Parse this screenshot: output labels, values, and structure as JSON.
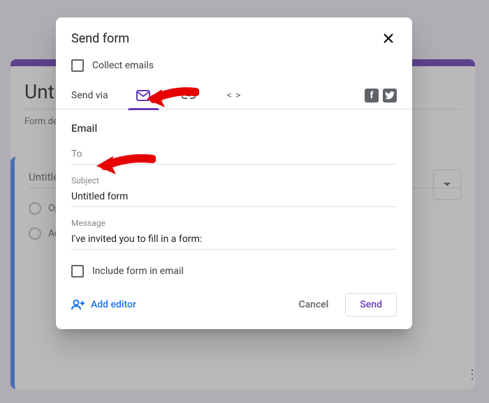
{
  "background": {
    "title": "Untit",
    "desc": "Form desc",
    "question_title": "Untitle",
    "option1": "Optio",
    "option_add": "Add o"
  },
  "dialog": {
    "title": "Send form",
    "collect_label": "Collect emails",
    "sendvia_label": "Send via",
    "section": "Email",
    "to_placeholder": "To",
    "subject_label": "Subject",
    "subject_value": "Untitled form",
    "message_label": "Message",
    "message_value": "I've invited you to fill in a form:",
    "include_label": "Include form in email",
    "add_editor": "Add editor",
    "cancel": "Cancel",
    "send": "Send"
  },
  "icons": {
    "facebook": "f",
    "twitter": "t",
    "embed": "< >"
  }
}
